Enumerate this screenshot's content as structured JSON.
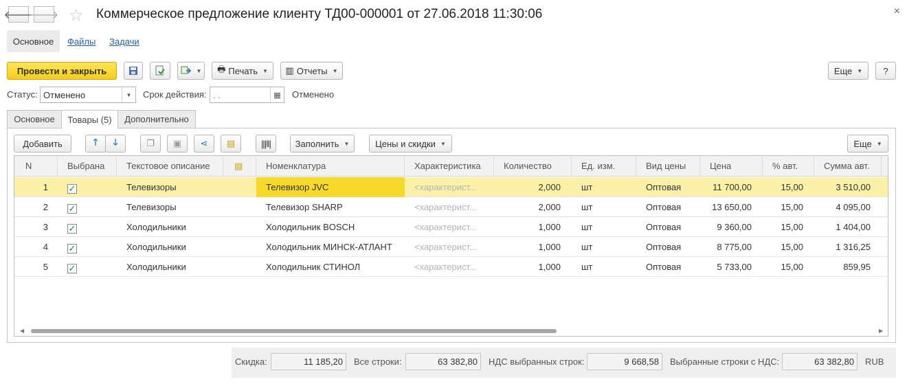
{
  "window": {
    "title": "Коммерческое предложение клиенту ТД00-000001 от 27.06.2018 11:30:06"
  },
  "sections": {
    "main": "Основное",
    "files": "Файлы",
    "tasks": "Задачи"
  },
  "toolbar": {
    "post_close": "Провести и закрыть",
    "print": "Печать",
    "reports": "Отчеты",
    "more": "Еще",
    "help": "?"
  },
  "status_row": {
    "status_label": "Статус:",
    "status_value": "Отменено",
    "validity_label": "Срок действия:",
    "validity_value": " .  . ",
    "state_text": "Отменено"
  },
  "tabs": {
    "main": "Основное",
    "goods": "Товары (5)",
    "extra": "Дополнительно"
  },
  "table_toolbar": {
    "add": "Добавить",
    "fill": "Заполнить",
    "prices": "Цены и скидки",
    "more": "Еще"
  },
  "table": {
    "columns": [
      "N",
      "Выбрана",
      "Текстовое описание",
      "",
      "Номенклатура",
      "Характеристика",
      "Количество",
      "Ед. изм.",
      "Вид цены",
      "Цена",
      "% авт.",
      "Сумма авт."
    ],
    "rows": [
      {
        "n": "1",
        "checked": "✓",
        "desc": "Телевизоры",
        "item": "Телевизор JVC",
        "char": "<характерист...",
        "qty": "2,000",
        "unit": "шт",
        "price_type": "Оптовая",
        "price": "11 700,00",
        "pct": "15,00",
        "sum": "3 510,00"
      },
      {
        "n": "2",
        "checked": "✓",
        "desc": "Телевизоры",
        "item": "Телевизор SHARP",
        "char": "<характерист...",
        "qty": "2,000",
        "unit": "шт",
        "price_type": "Оптовая",
        "price": "13 650,00",
        "pct": "15,00",
        "sum": "4 095,00"
      },
      {
        "n": "3",
        "checked": "✓",
        "desc": "Холодильники",
        "item": "Холодильник BOSCH",
        "char": "<характерист...",
        "qty": "1,000",
        "unit": "шт",
        "price_type": "Оптовая",
        "price": "9 360,00",
        "pct": "15,00",
        "sum": "1 404,00"
      },
      {
        "n": "4",
        "checked": "✓",
        "desc": "Холодильники",
        "item": "Холодильник МИНСК-АТЛАНТ",
        "char": "<характерист...",
        "qty": "1,000",
        "unit": "шт",
        "price_type": "Оптовая",
        "price": "8 775,00",
        "pct": "15,00",
        "sum": "1 316,25"
      },
      {
        "n": "5",
        "checked": "✓",
        "desc": "Холодильники",
        "item": "Холодильник СТИНОЛ",
        "char": "<характерист...",
        "qty": "1,000",
        "unit": "шт",
        "price_type": "Оптовая",
        "price": "5 733,00",
        "pct": "15,00",
        "sum": "859,95"
      }
    ]
  },
  "footer": {
    "discount_label": "Скидка:",
    "discount_value": "11 185,20",
    "all_rows_label": "Все строки:",
    "all_rows_value": "63 382,80",
    "vat_label": "НДС выбранных строк:",
    "vat_value": "9 668,58",
    "selected_vat_label": "Выбранные строки с НДС:",
    "selected_vat_value": "63 382,80",
    "currency": "RUB"
  },
  "colors": {
    "primary_button": "#f5ce17",
    "selected_row": "#fbf1a9",
    "highlight_cell": "#f6d92a",
    "link": "#2a5bb0"
  }
}
